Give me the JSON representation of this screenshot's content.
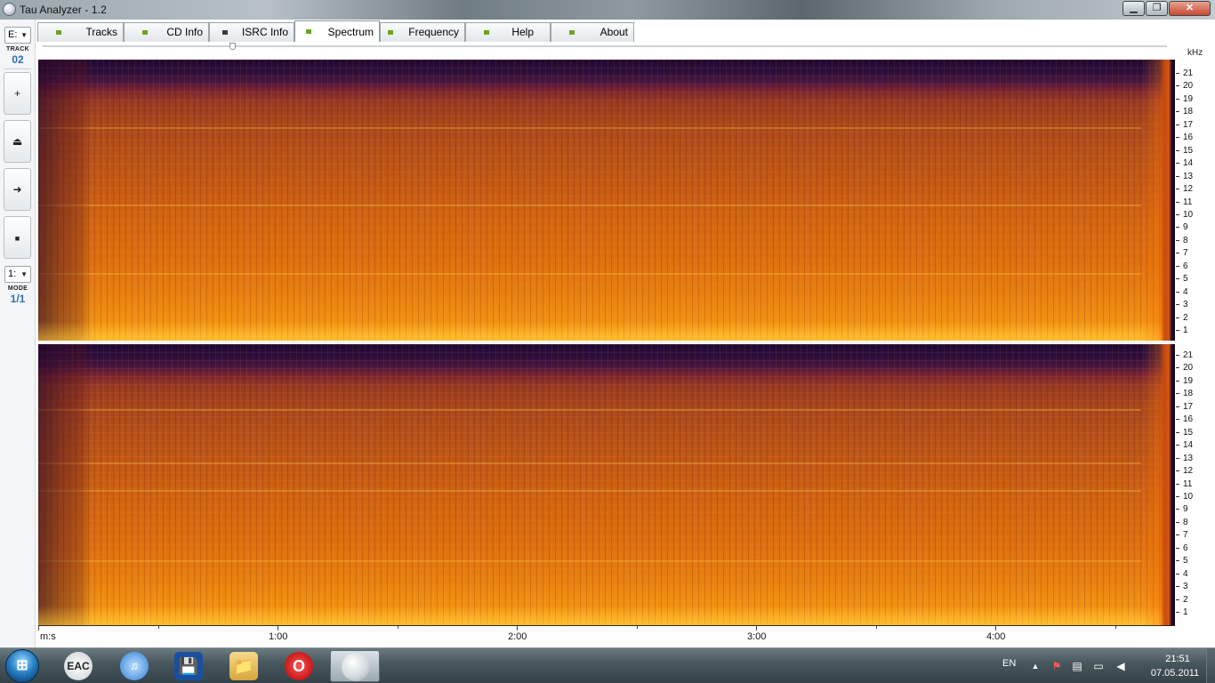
{
  "window": {
    "title": "Tau Analyzer - 1.2",
    "controls": {
      "minimize": "▁",
      "maximize": "❐",
      "close": "✕"
    }
  },
  "left_panel": {
    "drive": {
      "value": "E:"
    },
    "track": {
      "label": "TRACK",
      "value": "02"
    },
    "buttons": [
      {
        "icon": "plus-icon",
        "glyph": "+"
      },
      {
        "icon": "eject-icon",
        "glyph": "⏏"
      },
      {
        "icon": "play-icon",
        "glyph": "➜"
      },
      {
        "icon": "stop-icon",
        "glyph": "■"
      }
    ],
    "mode_select": {
      "value": "1:"
    },
    "mode": {
      "label": "MODE",
      "value": "1/1"
    }
  },
  "tabs": [
    {
      "label": "Tracks",
      "led": "#6aa51f",
      "active": false
    },
    {
      "label": "CD Info",
      "led": "#6aa51f",
      "active": false
    },
    {
      "label": "ISRC Info",
      "led": "#3a3a3a",
      "active": false
    },
    {
      "label": "Spectrum",
      "led": "#6aa51f",
      "active": true
    },
    {
      "label": "Frequency",
      "led": "#6aa51f",
      "active": false
    },
    {
      "label": "Help",
      "led": "#6aa51f",
      "active": false
    },
    {
      "label": "About",
      "led": "#6aa51f",
      "active": false
    }
  ],
  "spectrum": {
    "unit_label": "kHz",
    "freq_ticks": [
      "21",
      "20",
      "19",
      "18",
      "17",
      "16",
      "15",
      "14",
      "13",
      "12",
      "11",
      "10",
      "9",
      "8",
      "7",
      "6",
      "5",
      "4",
      "3",
      "2",
      "1"
    ],
    "time_unit": "m:s",
    "time_labels": [
      "1:00",
      "2:00",
      "3:00",
      "4:00"
    ],
    "colors": {
      "hot": "#ffb020",
      "mid": "#d36611",
      "cold": "#1f0a33"
    }
  },
  "taskbar": {
    "start_label": "⊞",
    "apps": [
      {
        "name": "eac",
        "label": "EAC",
        "color": "#ffffff"
      },
      {
        "name": "itunes",
        "label": "♫",
        "color": "#2e7fd6"
      },
      {
        "name": "save",
        "label": "💾",
        "color": "#1a4fa0"
      },
      {
        "name": "explorer",
        "label": "📁",
        "color": "#e3b44b"
      },
      {
        "name": "opera",
        "label": "O",
        "color": "#cc1111"
      },
      {
        "name": "tau-analyzer",
        "label": "",
        "color": "#ffffff"
      }
    ],
    "tray": {
      "language": "EN",
      "time": "21:51",
      "date": "07.05.2011"
    }
  }
}
